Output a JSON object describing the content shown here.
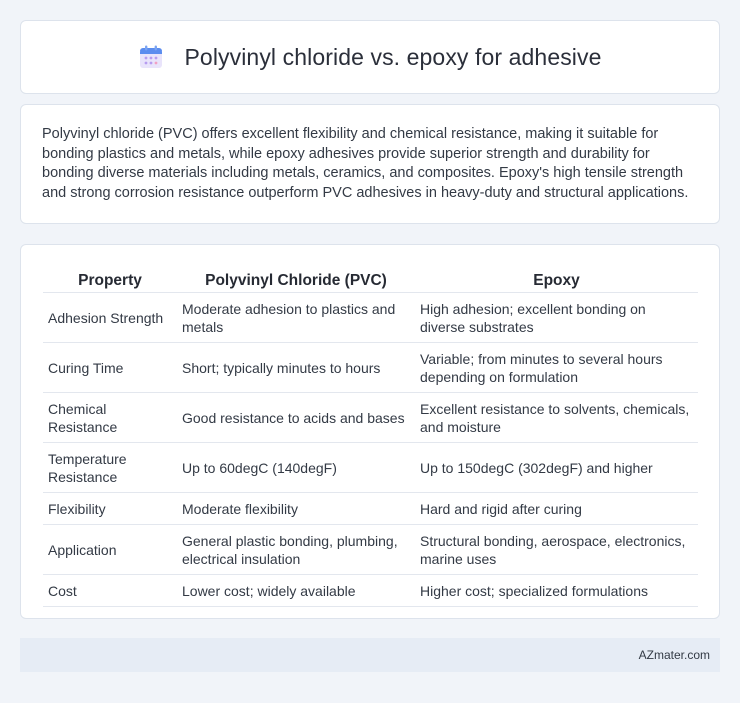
{
  "header": {
    "title": "Polyvinyl chloride vs. epoxy for adhesive",
    "icon": "calendar-icon"
  },
  "intro": {
    "text": "Polyvinyl chloride (PVC) offers excellent flexibility and chemical resistance, making it suitable for bonding plastics and metals, while epoxy adhesives provide superior strength and durability for bonding diverse materials including metals, ceramics, and composites. Epoxy's high tensile strength and strong corrosion resistance outperform PVC adhesives in heavy-duty and structural applications."
  },
  "table": {
    "headers": [
      "Property",
      "Polyvinyl Chloride (PVC)",
      "Epoxy"
    ],
    "rows": [
      [
        "Adhesion Strength",
        "Moderate adhesion to plastics and metals",
        "High adhesion; excellent bonding on diverse substrates"
      ],
      [
        "Curing Time",
        "Short; typically minutes to hours",
        "Variable; from minutes to several hours depending on formulation"
      ],
      [
        "Chemical Resistance",
        "Good resistance to acids and bases",
        "Excellent resistance to solvents, chemicals, and moisture"
      ],
      [
        "Temperature Resistance",
        "Up to 60degC (140degF)",
        "Up to 150degC (302degF) and higher"
      ],
      [
        "Flexibility",
        "Moderate flexibility",
        "Hard and rigid after curing"
      ],
      [
        "Application",
        "General plastic bonding, plumbing, electrical insulation",
        "Structural bonding, aerospace, electronics, marine uses"
      ],
      [
        "Cost",
        "Lower cost; widely available",
        "Higher cost; specialized formulations"
      ]
    ]
  },
  "footer": {
    "brand": "AZmater.com"
  }
}
